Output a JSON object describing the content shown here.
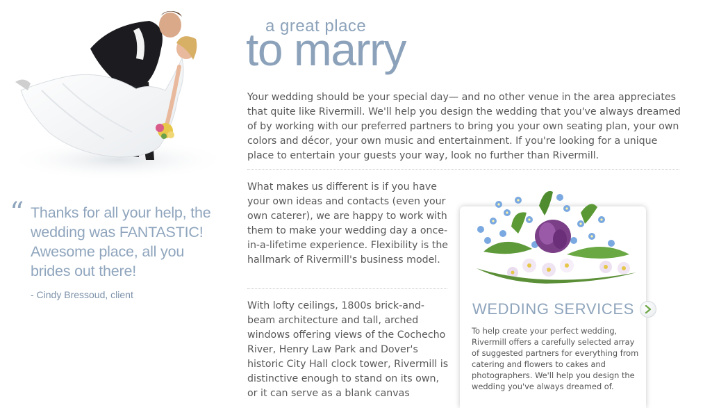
{
  "heading": {
    "line_small": "a great place",
    "line_big": "to marry"
  },
  "intro": "Your wedding should be your special day— and no other venue in the area appreciates that quite like Rivermill. We'll help you design the wedding that you've always dreamed of by working with our preferred partners to bring you your own seating plan, your own colors and décor, your own music and entertainment. If you're looking for a unique place to entertain your guests your way, look no further than Rivermill.",
  "paragraphs": {
    "difference": "What makes us different is if you have your own ideas and contacts (even your own caterer), we are happy to work with them to make your wedding day a once-in-a-lifetime experience. Flexibility is the hallmark of Rivermill's business model.",
    "architecture": "With lofty ceilings, 1800s brick-and-beam architecture and tall, arched windows offering views of the Cochecho River, Henry Law Park and Dover's historic City Hall clock tower, Rivermill is distinctive enough to stand on its own, or it can serve as a blank canvas"
  },
  "testimonial": {
    "quote_mark": "“",
    "text": "Thanks for all your help, the wedding was FANTASTIC! Awesome place, all you brides out there!",
    "author": "- Cindy Bressoud, client"
  },
  "services": {
    "title": "WEDDING SERVICES",
    "description": "To help create your perfect wedding, Rivermill offers a carefully selected array of suggested partners for everything from catering and flowers to cakes and photographers. We'll help you design the wedding you've always dreamed of."
  },
  "icons": {
    "quote": "quote-icon",
    "arrow": "arrow-right-circle-icon"
  },
  "colors": {
    "accent_blue": "#8ca2ba",
    "body_text": "#585858"
  }
}
